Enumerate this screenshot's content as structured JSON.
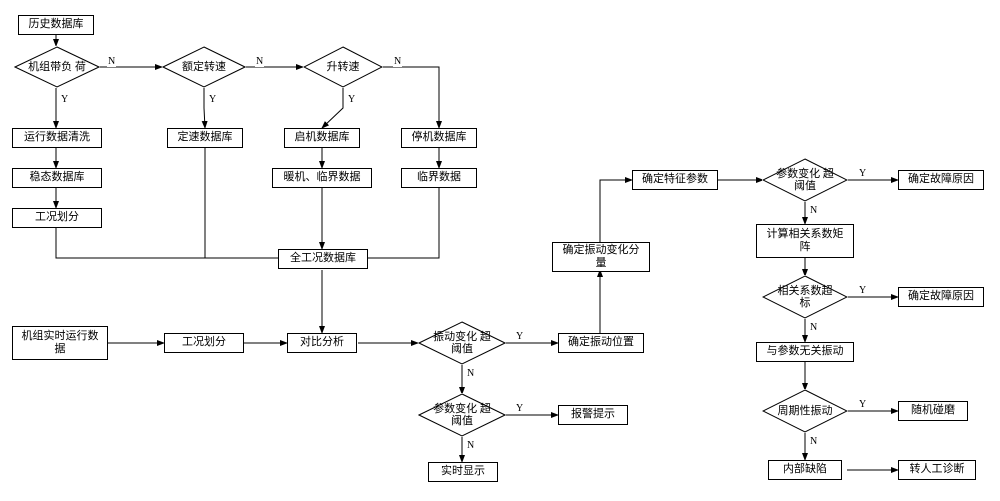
{
  "nodes": {
    "hist_db": "历史数据库",
    "unit_load": "机组带负\n荷",
    "rated_speed": "额定转速",
    "speed_up": "升转速",
    "run_clean": "运行数据清洗",
    "speed_db": "定速数据库",
    "start_db": "启机数据库",
    "stop_db": "停机数据库",
    "stable_db": "稳态数据库",
    "warmup": "暖机、临界数据",
    "critical": "临界数据",
    "cond_div1": "工况划分",
    "all_cond_db": "全工况数据库",
    "rt_data": "机组实时运行数\n据",
    "cond_div2": "工况划分",
    "compare": "对比分析",
    "vib_thresh": "振动变化\n超阈值",
    "param_thresh1": "参数变化\n超阈值",
    "rt_display": "实时显示",
    "alarm": "报警提示",
    "det_vib_pos": "确定振动位置",
    "det_vib_comp": "确定振动变化分\n量",
    "det_feat": "确定特征参数",
    "param_thresh2": "参数变化\n超阈值",
    "det_fault1": "确定故障原因",
    "calc_corr": "计算相关系数矩\n阵",
    "corr_over": "相关系数超\n标",
    "det_fault2": "确定故障原因",
    "indep_vib": "与参数无关振动",
    "periodic": "周期性振动",
    "random_rub": "随机碰磨",
    "internal_defect": "内部缺陷",
    "manual": "转人工诊断"
  },
  "labels": {
    "yes": "Y",
    "no": "N"
  }
}
